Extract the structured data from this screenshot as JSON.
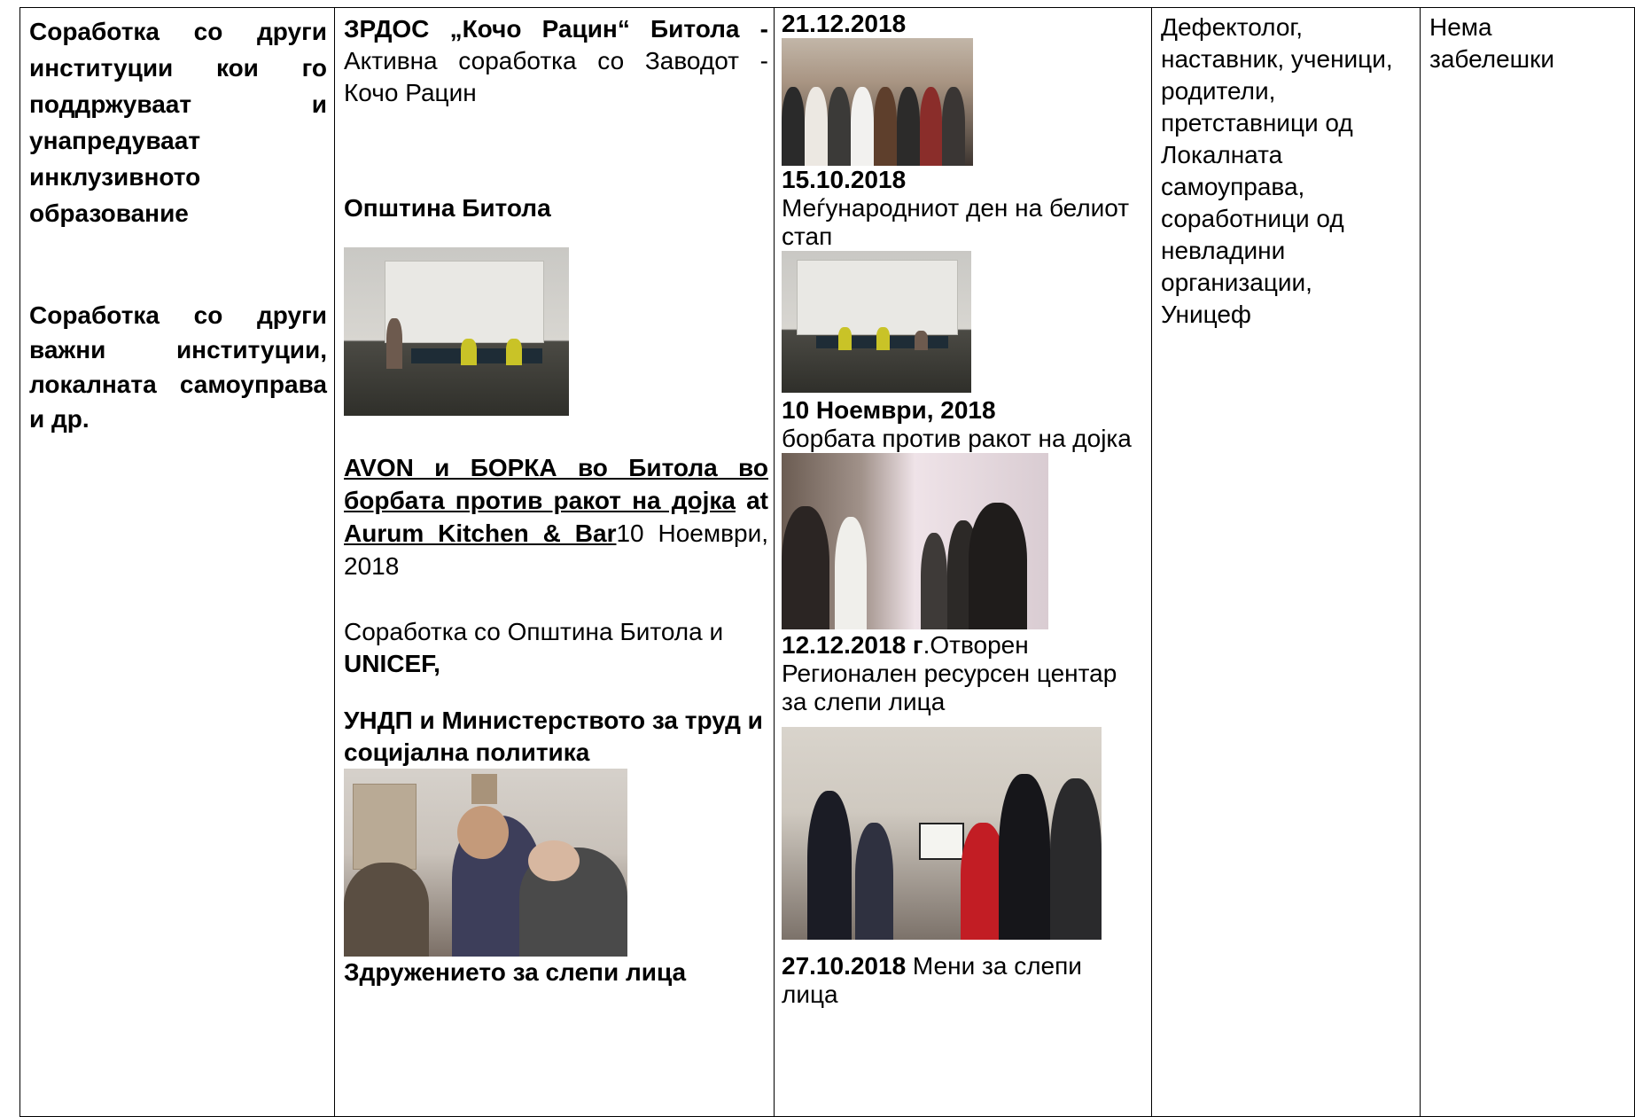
{
  "col1": {
    "heading1": "Соработка со други институции кои го поддржуваат и унапредуваат инклузивното образование",
    "heading2": "Соработка со други важни институции, локалната самоуправа и др."
  },
  "col2": {
    "org_bold": "ЗРДОС „Кочо Рацин“ Битола -",
    "org_text": " Активна соработка со Заводот - Кочо Рацин",
    "municipality": "Општина Битола",
    "avon_link": "AVON и БОРКА во Битола во борбата против ракот на дојка",
    "avon_at": " at ",
    "avon_venue": "Aurum Kitchen & Bar",
    "avon_date": "10 Ноември, 2018",
    "cooperation_text": "Соработка со Општина Битола и ",
    "cooperation_bold": "UNICEF,",
    "undp": "УНДП и Министерството за труд и социјална политика",
    "association": "Здружението за слепи лица"
  },
  "col3": {
    "date1": "21.12.2018",
    "date2": "15.10.2018",
    "event2": "Меѓународниот ден на белиот стап",
    "date3": "10 Ноември, 2018",
    "event3": "борбата против ракот на дојка",
    "date4": "12.12.2018 г",
    "event4": ".Отворен Регионален ресурсен центар за слепи лица",
    "date5": "27.10.2018",
    "event5": " Мени за слепи лица"
  },
  "col4": {
    "participants": "Дефектолог, наставник, ученици, родители, претставници од Локалната самоуправа, соработници од невладини организации, Уницеф"
  },
  "col5": {
    "notes": "Нема забелешки"
  }
}
